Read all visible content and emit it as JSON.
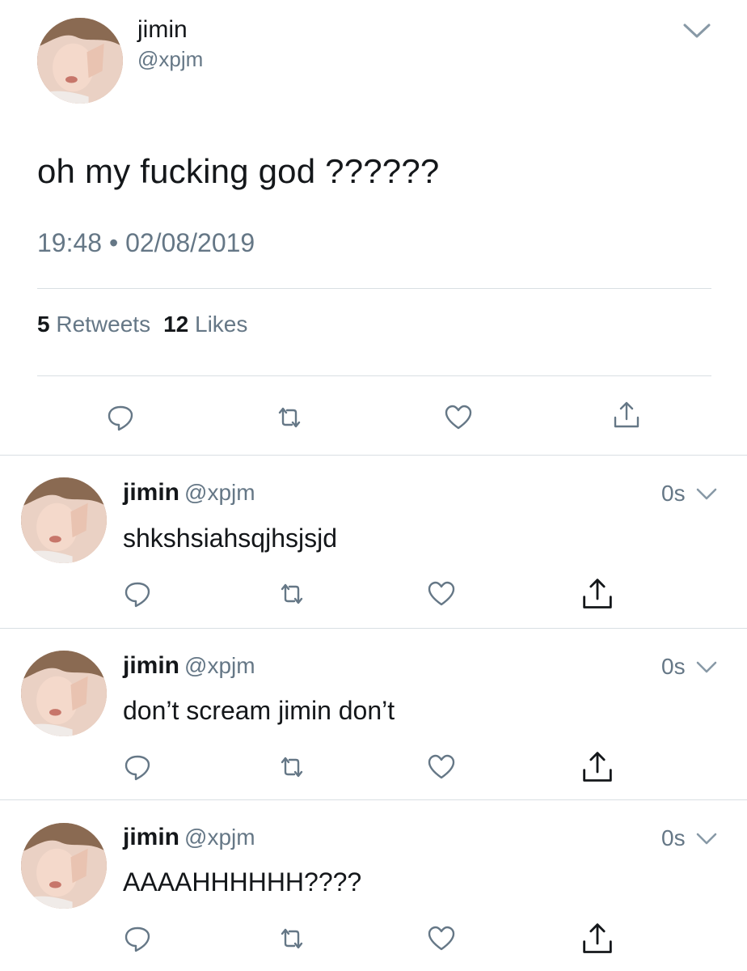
{
  "main_tweet": {
    "name": "jimin",
    "handle": "@xpjm",
    "text": "oh my fucking god ??????",
    "time": "19:48",
    "separator": "•",
    "date": "02/08/2019",
    "retweets_count": "5",
    "retweets_label": "Retweets",
    "likes_count": "12",
    "likes_label": "Likes"
  },
  "replies": [
    {
      "name": "jimin",
      "handle": "@xpjm",
      "time": "0s",
      "text": "shkshsiahsqjhsjsjd"
    },
    {
      "name": "jimin",
      "handle": "@xpjm",
      "time": "0s",
      "text": "don’t scream jimin don’t"
    },
    {
      "name": "jimin",
      "handle": "@xpjm",
      "time": "0s",
      "text": "AAAAHHHHHH????"
    }
  ],
  "icons": {
    "reply": "reply-icon",
    "retweet": "retweet-icon",
    "like": "heart-icon",
    "share": "share-icon",
    "caret": "chevron-down-icon"
  },
  "colors": {
    "text": "#14171a",
    "secondary": "#657786",
    "divider": "#d9dfe3",
    "icon": "#657786"
  }
}
